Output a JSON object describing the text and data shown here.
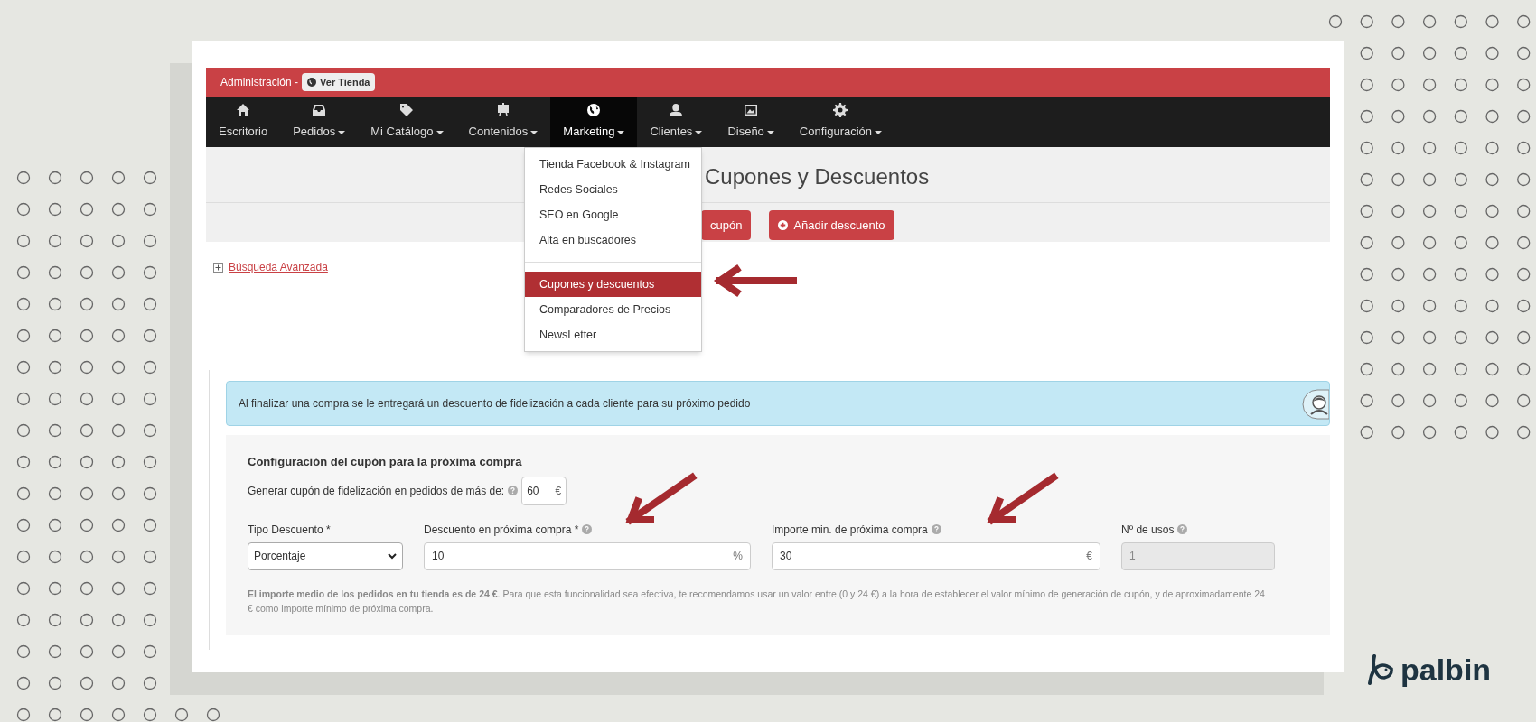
{
  "header": {
    "admin_label": "Administración -",
    "view_store_button": "Ver Tienda"
  },
  "nav": [
    {
      "label": "Escritorio",
      "has_menu": false,
      "selected": false
    },
    {
      "label": "Pedidos",
      "has_menu": true,
      "selected": false
    },
    {
      "label": "Mi Catálogo",
      "has_menu": true,
      "selected": false
    },
    {
      "label": "Contenidos",
      "has_menu": true,
      "selected": false
    },
    {
      "label": "Marketing",
      "has_menu": true,
      "selected": true
    },
    {
      "label": "Clientes",
      "has_menu": true,
      "selected": false
    },
    {
      "label": "Diseño",
      "has_menu": true,
      "selected": false
    },
    {
      "label": "Configuración",
      "has_menu": true,
      "selected": false
    }
  ],
  "marketing_menu": [
    [
      {
        "label": "Tienda Facebook & Instagram",
        "selected": false
      },
      {
        "label": "Redes Sociales",
        "selected": false
      },
      {
        "label": "SEO en Google",
        "selected": false
      },
      {
        "label": "Alta en buscadores",
        "selected": false
      }
    ],
    [
      {
        "label": "Cupones y descuentos",
        "selected": true
      },
      {
        "label": "Comparadores de Precios",
        "selected": false
      },
      {
        "label": "NewsLetter",
        "selected": false
      }
    ]
  ],
  "page_title": "Cupones y Descuentos",
  "buttons": [
    {
      "label": "cupón",
      "icon": false
    },
    {
      "label": "Añadir descuento",
      "icon": true
    }
  ],
  "advanced_search": "Búsqueda Avanzada",
  "info_banner": "Al finalizar una compra se le entregará un descuento de fidelización a cada cliente para su próximo pedido",
  "config": {
    "title": "Configuración del cupón para la próxima compra",
    "threshold": {
      "label": "Generar cupón de fidelización en pedidos de más de:",
      "value": "60",
      "unit": "€"
    },
    "fields": [
      {
        "kind": "select",
        "label": "Tipo Descuento *",
        "value": "Porcentaje",
        "help": false,
        "disabled": false
      },
      {
        "kind": "input",
        "label": "Descuento en próxima compra *",
        "value": "10",
        "unit": "%",
        "help": true,
        "disabled": false
      },
      {
        "kind": "input",
        "label": "Importe min. de próxima compra",
        "value": "30",
        "unit": "€",
        "help": true,
        "disabled": false
      },
      {
        "kind": "input",
        "label": "Nº de usos",
        "value": "1",
        "help": true,
        "disabled": true
      }
    ],
    "note": "**El importe medio de los pedidos en tu tienda es de 24 €**. Para que esta funcionalidad sea efectiva, te recomendamos usar un valor entre (0 y 24 €) a la hora de establecer el valor mínimo de generación de cupón, y de aproximadamente 24 € como importe mínimo de próxima compra."
  },
  "brand": "palbin"
}
